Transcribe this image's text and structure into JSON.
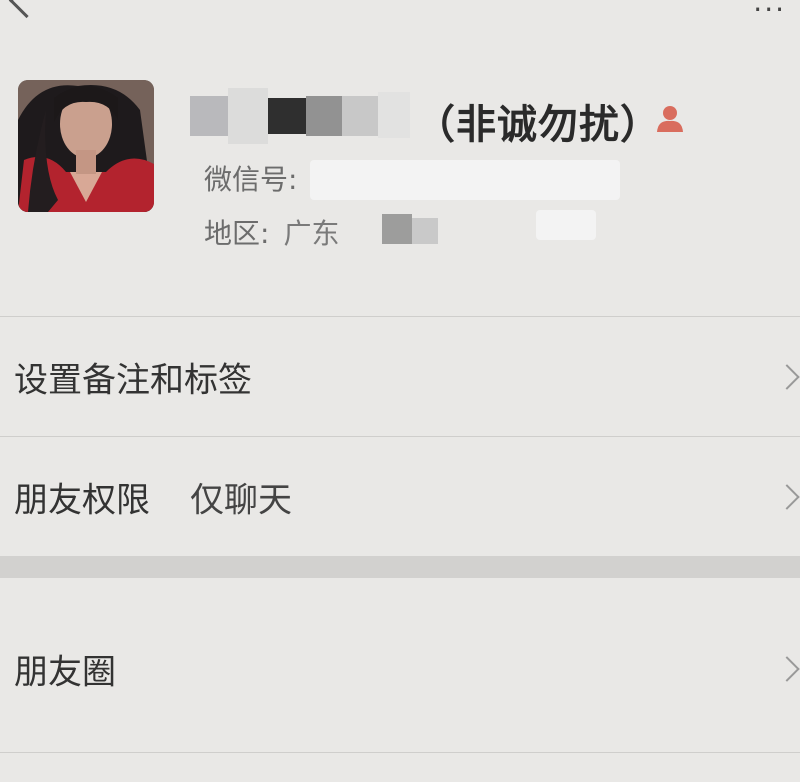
{
  "header": {
    "back_icon": "back-icon",
    "more_icon": "more-icon"
  },
  "profile": {
    "nickname_suffix": "（非诚勿扰）",
    "wechat_id_label": "微信号:",
    "region_label": "地区:",
    "region_value": "广东",
    "gender_icon": "user-icon",
    "gender_icon_color": "#d96d5e"
  },
  "menu": {
    "items": [
      {
        "label": "设置备注和标签",
        "value": ""
      },
      {
        "label": "朋友权限",
        "value": "仅聊天"
      },
      {
        "label": "朋友圈",
        "value": ""
      }
    ]
  }
}
